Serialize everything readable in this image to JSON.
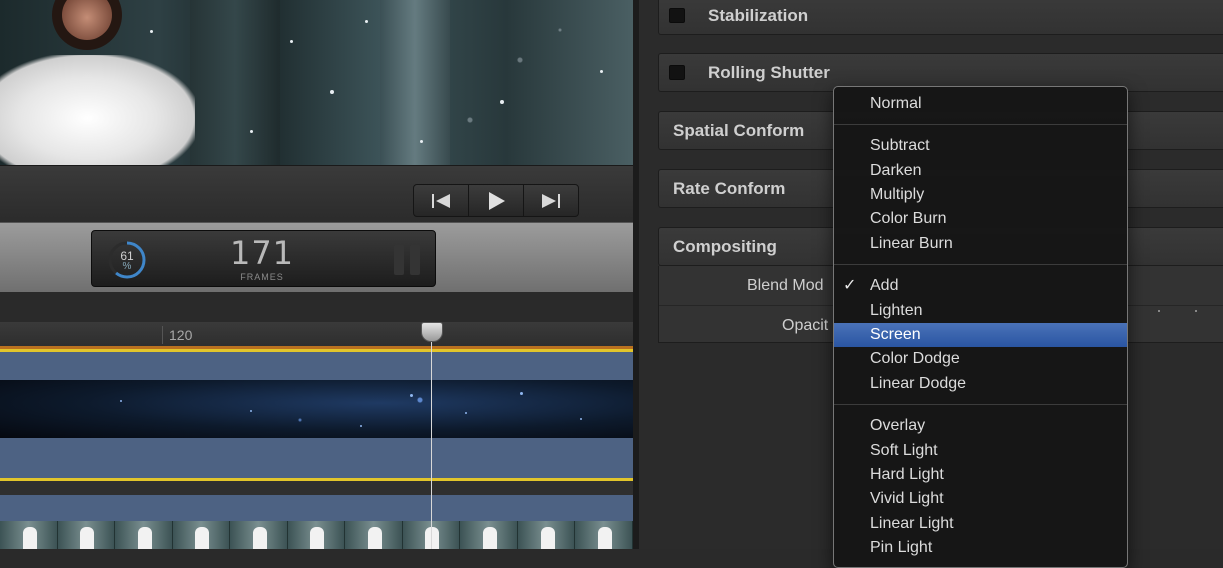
{
  "viewer": {
    "transport": {
      "prev_icon": "skip-back-icon",
      "play_icon": "play-icon",
      "next_icon": "skip-forward-icon"
    }
  },
  "dashboard": {
    "render_percent": "61",
    "percent_symbol": "%",
    "frame_count": "171",
    "frame_label": "FRAMES",
    "progress": 0.61
  },
  "timeline": {
    "ruler_label": "120"
  },
  "inspector": {
    "sections": [
      {
        "title": "Stabilization",
        "has_checkbox": true
      },
      {
        "title": "Rolling Shutter",
        "has_checkbox": true
      },
      {
        "title": "Spatial Conform",
        "has_checkbox": false
      },
      {
        "title": "Rate Conform",
        "has_checkbox": false
      },
      {
        "title": "Compositing",
        "has_checkbox": false
      }
    ],
    "compositing": {
      "blend_mode_label": "Blend Mod",
      "opacity_label": "Opacit"
    }
  },
  "blend_menu": {
    "checked_item": "Add",
    "highlighted_item": "Screen",
    "groups": [
      [
        "Normal"
      ],
      [
        "Subtract",
        "Darken",
        "Multiply",
        "Color Burn",
        "Linear Burn"
      ],
      [
        "Add",
        "Lighten",
        "Screen",
        "Color Dodge",
        "Linear Dodge"
      ],
      [
        "Overlay",
        "Soft Light",
        "Hard Light",
        "Vivid Light",
        "Linear Light",
        "Pin Light"
      ]
    ],
    "check_glyph": "✓"
  },
  "colors": {
    "menu_highlight": "#2f5aa6",
    "timeline_track": "#4d6283",
    "track_accent": "#e2c52b"
  }
}
